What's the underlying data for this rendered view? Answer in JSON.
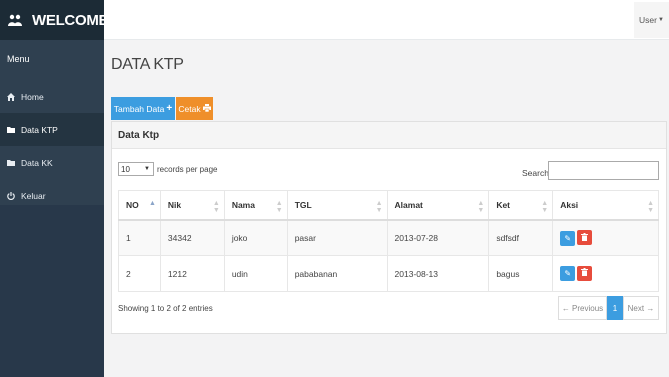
{
  "brand": {
    "title": "WELCOME"
  },
  "topbar": {
    "user_label": "User"
  },
  "sidebar": {
    "menu_label": "Menu",
    "items": [
      {
        "label": "Home",
        "icon": "home-icon"
      },
      {
        "label": "Data KTP",
        "icon": "folder-icon"
      },
      {
        "label": "Data KK",
        "icon": "folder-icon"
      },
      {
        "label": "Keluar",
        "icon": "power-icon"
      }
    ]
  },
  "page": {
    "title": "DATA KTP"
  },
  "toolbar": {
    "add_label": "Tambah Data",
    "print_label": "Cetak"
  },
  "panel": {
    "heading": "Data Ktp"
  },
  "table_controls": {
    "page_length": "10",
    "length_label": "records per page",
    "search_label": "Search:",
    "search_value": ""
  },
  "table": {
    "columns": [
      "NO",
      "Nik",
      "Nama",
      "TGL",
      "Alamat",
      "Ket",
      "Aksi"
    ],
    "rows": [
      {
        "no": "1",
        "nik": "34342",
        "nama": "joko",
        "tgl": "pasar",
        "alamat": "2013-07-28",
        "ket": "sdfsdf"
      },
      {
        "no": "2",
        "nik": "1212",
        "nama": "udin",
        "tgl": "pababanan",
        "alamat": "2013-08-13",
        "ket": "bagus"
      }
    ]
  },
  "footer": {
    "info": "Showing 1 to 2 of 2 entries",
    "prev_label": "← Previous",
    "current_page": "1",
    "next_label": "Next →"
  },
  "colors": {
    "sidebar": "#2f4050",
    "primary": "#3c9de0",
    "warning": "#ef8f2a",
    "danger": "#e74c3c"
  }
}
